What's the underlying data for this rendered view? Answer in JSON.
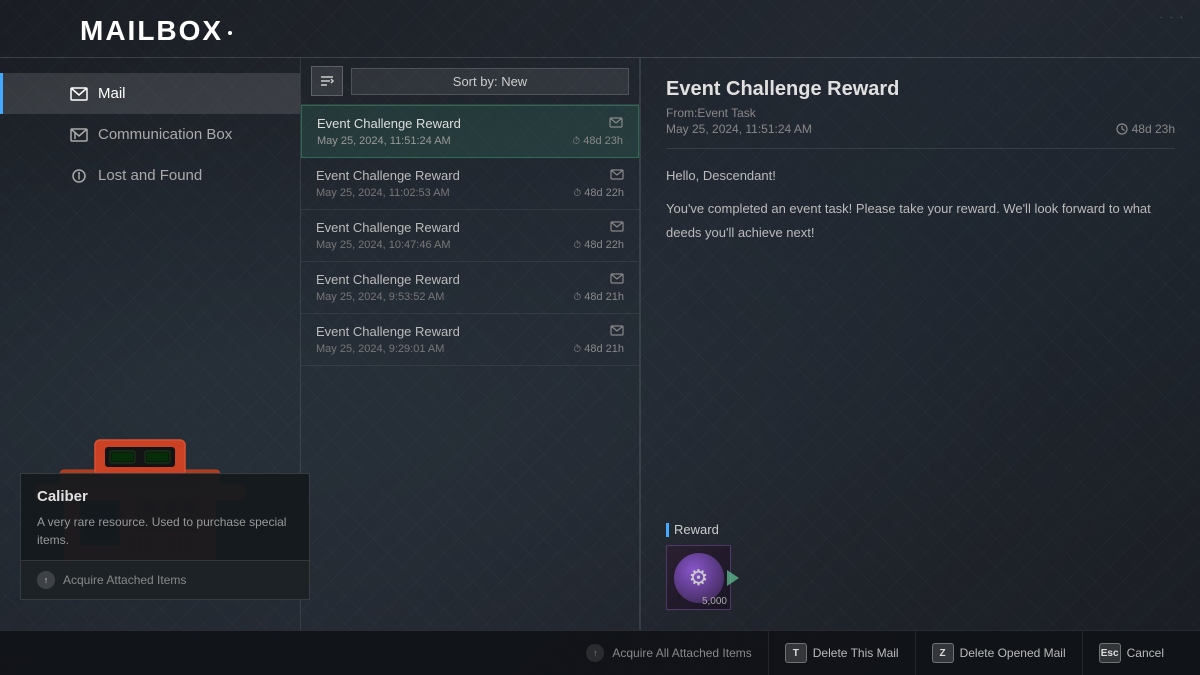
{
  "header": {
    "title": "Mailbox"
  },
  "sidebar": {
    "items": [
      {
        "id": "mail",
        "label": "Mail",
        "icon": "mail-icon",
        "active": true
      },
      {
        "id": "communication",
        "label": "Communication Box",
        "icon": "communication-icon",
        "active": false
      },
      {
        "id": "lost-found",
        "label": "Lost and Found",
        "icon": "lost-found-icon",
        "active": false
      }
    ]
  },
  "sort_bar": {
    "label": "Sort by: New",
    "icon": "sort-icon"
  },
  "mail_items": [
    {
      "id": 1,
      "title": "Event Challenge Reward",
      "date": "May 25, 2024, 11:51:24 AM",
      "time_remaining": "48d 23h",
      "selected": true
    },
    {
      "id": 2,
      "title": "Event Challenge Reward",
      "date": "May 25, 2024, 11:02:53 AM",
      "time_remaining": "48d 22h",
      "selected": false
    },
    {
      "id": 3,
      "title": "Event Challenge Reward",
      "date": "May 25, 2024, 10:47:46 AM",
      "time_remaining": "48d 22h",
      "selected": false
    },
    {
      "id": 4,
      "title": "Event Challenge Reward",
      "date": "May 25, 2024, 9:53:52 AM",
      "time_remaining": "48d 21h",
      "selected": false
    },
    {
      "id": 5,
      "title": "Event Challenge Reward",
      "date": "May 25, 2024, 9:29:01 AM",
      "time_remaining": "48d 21h",
      "selected": false
    }
  ],
  "mail_detail": {
    "title": "Event Challenge Reward",
    "from_label": "From:",
    "from_value": "Event Task",
    "date": "May 25, 2024, 11:51:24 AM",
    "time_remaining": "48d 23h",
    "body_greeting": "Hello, Descendant!",
    "body_text": "You've completed an event task! Please take your reward. We'll look forward to what deeds you'll achieve next!",
    "reward_label": "Reward",
    "reward_item_name": "Caliber",
    "reward_item_count": "5,000"
  },
  "tooltip": {
    "title": "Caliber",
    "description": "A very rare resource. Used to purchase special items.",
    "action_label": "Acquire Attached Items",
    "action_icon": "acquire-icon"
  },
  "bottom_bar": {
    "acquire_all_label": "Acquire All Attached Items",
    "delete_this_key": "T",
    "delete_this_label": "Delete This Mail",
    "delete_opened_key": "Z",
    "delete_opened_label": "Delete Opened Mail",
    "cancel_key": "Esc",
    "cancel_label": "Cancel"
  },
  "colors": {
    "accent": "#4af",
    "selected_border": "rgba(60,180,120,0.4)",
    "background": "#1a1e24"
  }
}
